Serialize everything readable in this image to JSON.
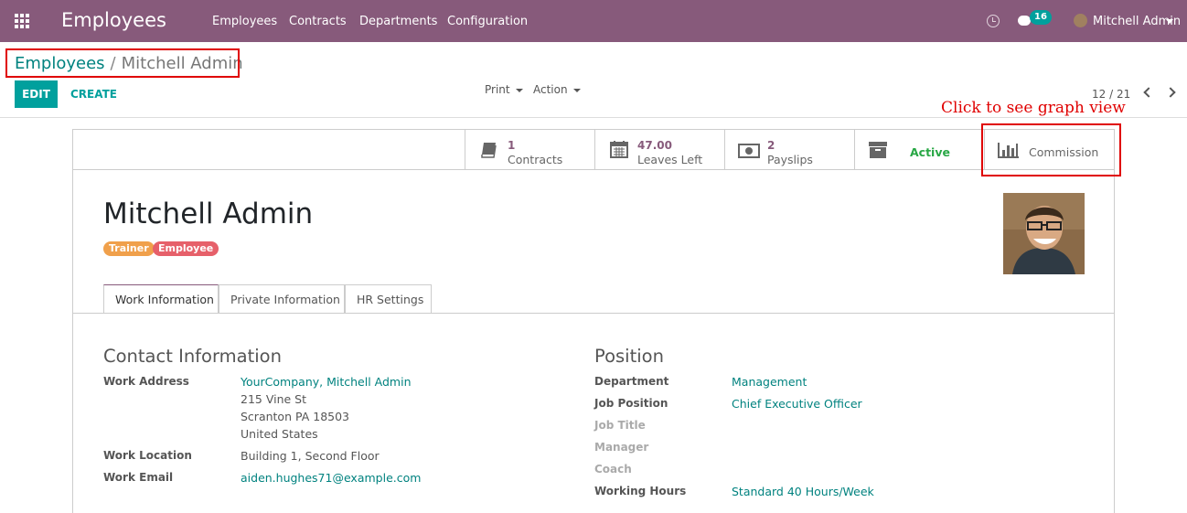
{
  "navbar": {
    "brand": "Employees",
    "menu": [
      "Employees",
      "Contracts",
      "Departments",
      "Configuration"
    ],
    "message_count": "16",
    "user": "Mitchell Admin",
    "bg_color": "#875a7b"
  },
  "breadcrumb": {
    "parent": "Employees",
    "separator": "/",
    "current": "Mitchell Admin"
  },
  "toolbar": {
    "edit": "EDIT",
    "create": "CREATE",
    "print": "Print",
    "action": "Action",
    "pager": "12 / 21"
  },
  "annotation": {
    "callout": "Click to see graph view"
  },
  "smart_buttons": {
    "contracts": {
      "value": "1",
      "label": "Contracts",
      "icon": "book-icon"
    },
    "leaves": {
      "value": "47.00",
      "label": "Leaves Left",
      "icon": "calendar-icon"
    },
    "payslips": {
      "value": "2",
      "label": "Payslips",
      "icon": "money-icon"
    },
    "active": {
      "label": "Active",
      "icon": "archive-icon"
    },
    "commission": {
      "label": "Commission",
      "icon": "bar-chart-icon"
    }
  },
  "employee": {
    "name": "Mitchell Admin",
    "tags": [
      {
        "label": "Trainer",
        "color": "#f0a04b"
      },
      {
        "label": "Employee",
        "color": "#e6606a"
      }
    ]
  },
  "tabs": [
    "Work Information",
    "Private Information",
    "HR Settings"
  ],
  "contact": {
    "title": "Contact Information",
    "work_address_label": "Work Address",
    "work_address_link": "YourCompany, Mitchell Admin",
    "address_lines": [
      "215 Vine St",
      "Scranton PA 18503",
      "United States"
    ],
    "work_location_label": "Work Location",
    "work_location": "Building 1, Second Floor",
    "work_email_label": "Work Email",
    "work_email": "aiden.hughes71@example.com"
  },
  "position": {
    "title": "Position",
    "department_label": "Department",
    "department": "Management",
    "job_position_label": "Job Position",
    "job_position": "Chief Executive Officer",
    "job_title_label": "Job Title",
    "manager_label": "Manager",
    "coach_label": "Coach",
    "working_hours_label": "Working Hours",
    "working_hours": "Standard 40 Hours/Week"
  }
}
